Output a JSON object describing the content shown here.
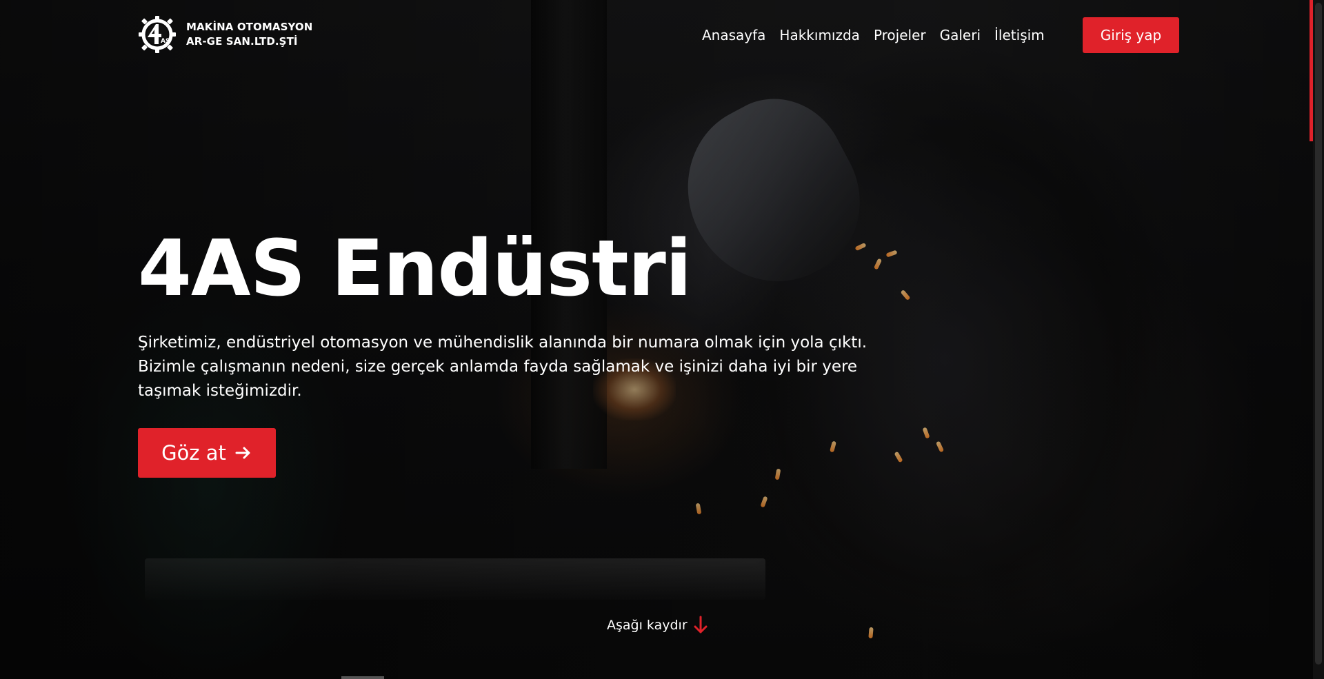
{
  "brand": {
    "logo_icon": "gear-4as-logo-icon",
    "line1": "MAKİNA OTOMASYON",
    "line2": "AR-GE SAN.LTD.ŞTİ"
  },
  "nav": {
    "items": [
      {
        "label": "Anasayfa"
      },
      {
        "label": "Hakkımızda"
      },
      {
        "label": "Projeler"
      },
      {
        "label": "Galeri"
      },
      {
        "label": "İletişim"
      }
    ],
    "login_label": "Giriş yap"
  },
  "hero": {
    "title": "4AS Endüstri",
    "description": "Şirketimiz, endüstriyel otomasyon ve mühendislik alanında bir numara olmak için yola çıktı. Bizimle çalışmanın nedeni, size gerçek anlamda fayda sağlamak ve işinizi daha iyi bir yere taşımak isteğimizdir.",
    "cta_label": "Göz at",
    "cta_icon": "arrow-right-icon"
  },
  "scroll_hint": {
    "label": "Aşağı kaydır",
    "icon": "arrow-down-icon"
  },
  "colors": {
    "accent": "#e0222a",
    "text": "#ffffff",
    "background": "#0b0b0c"
  }
}
